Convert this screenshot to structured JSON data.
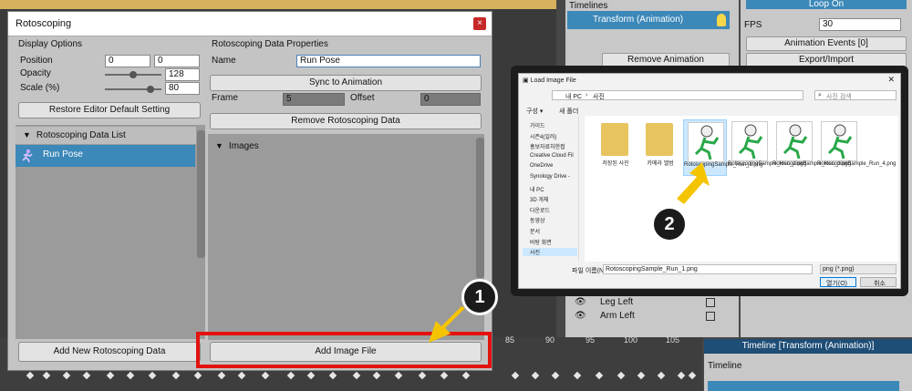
{
  "window": {
    "title": "Rotoscoping",
    "close_glyph": "×"
  },
  "display_options": {
    "heading": "Display Options",
    "position_label": "Position",
    "position_x": "0",
    "position_y": "0",
    "opacity_label": "Opacity",
    "opacity_value": "128",
    "opacity_level": 0.5,
    "scale_label": "Scale (%)",
    "scale_value": "80",
    "scale_level": 0.8,
    "restore_button": "Restore Editor Default Setting"
  },
  "data_list": {
    "heading": "Rotoscoping Data List",
    "items": [
      {
        "label": "Run Pose",
        "icon": "running-figure-icon"
      }
    ],
    "add_button": "Add New Rotoscoping Data"
  },
  "properties": {
    "heading": "Rotoscoping Data Properties",
    "name_label": "Name",
    "name_value": "Run Pose",
    "sync_button": "Sync to Animation",
    "frame_label": "Frame",
    "frame_value": "5",
    "offset_label": "Offset",
    "offset_value": "0",
    "remove_button": "Remove Rotoscoping Data",
    "images_heading": "Images",
    "add_image_button": "Add Image File"
  },
  "background_editor": {
    "timelines_label": "Timelines",
    "timeline_item": "Transform (Animation)",
    "loop_button": "Loop On",
    "fps_label": "FPS",
    "fps_value": "30",
    "events_button": "Animation Events [0]",
    "remove_animation": "Remove Animation",
    "export_import": "Export/Import",
    "layers": [
      "Leg Left",
      "Arm Left"
    ],
    "ruler_ticks": [
      "85",
      "90",
      "95",
      "100",
      "105"
    ],
    "timeline_header": "Timeline [Transform (Animation)]",
    "timeline_label": "Timeline"
  },
  "callouts": {
    "step1": "1",
    "step2": "2"
  },
  "file_dialog": {
    "title": "Load Image File",
    "breadcrumb": [
      "내 PC",
      "사진"
    ],
    "search_placeholder": "사진 검색",
    "toolbar": [
      "구성 ▾",
      "새 폴더"
    ],
    "nav_items": [
      "가이드",
      "시즌4(일러)",
      "홍보자료차한접",
      "Creative Cloud Fil",
      "OneDrive",
      "Synology Drive -",
      "내 PC",
      "3D 개체",
      "다운로드",
      "동영상",
      "문서",
      "바탕 화면",
      "사진"
    ],
    "files": [
      {
        "name": "저장된 사진",
        "kind": "folder"
      },
      {
        "name": "카메라 앨범",
        "kind": "folder"
      },
      {
        "name": "RotoscopingSample_Run_1.png",
        "kind": "image"
      },
      {
        "name": "RotoscopingSample_Run_2.png",
        "kind": "image"
      },
      {
        "name": "RotoscopingSample_Run_3.png",
        "kind": "image"
      },
      {
        "name": "RotoscopingSample_Run_4.png",
        "kind": "image"
      }
    ],
    "filename_label": "파일 이름(N):",
    "filename_value": "RotoscopingSample_Run_1.png",
    "filter_value": "png (*.png)",
    "open_button": "열기(O)",
    "cancel_button": "취소"
  },
  "colors": {
    "accent": "#3c88b8",
    "highlight": "#e3120e",
    "arrow": "#f5c400"
  }
}
